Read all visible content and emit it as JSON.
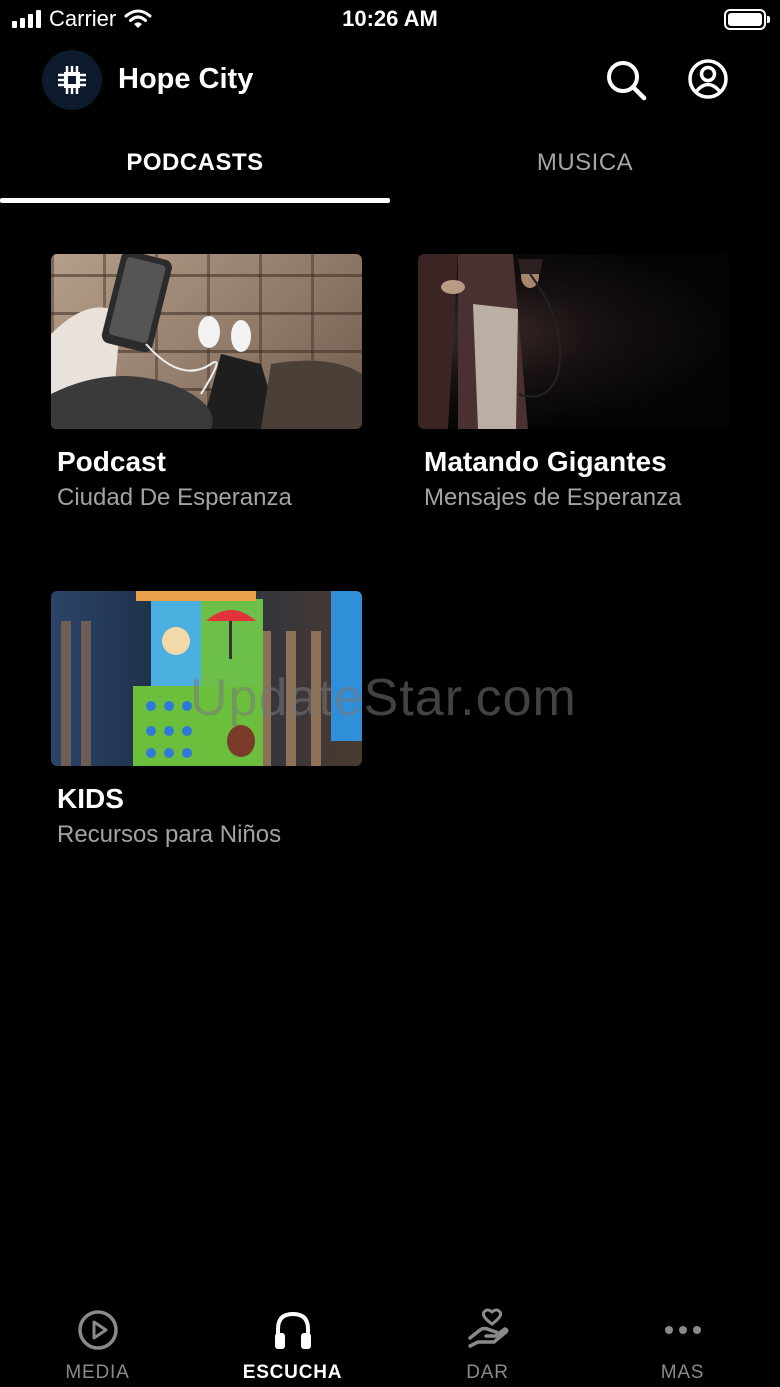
{
  "status_bar": {
    "carrier": "Carrier",
    "time": "10:26 AM"
  },
  "header": {
    "title": "Hope City",
    "logo_icon": "hope-city-logo",
    "search_icon": "search-icon",
    "account_icon": "account-icon"
  },
  "tabs": [
    {
      "label": "PODCASTS",
      "selected": true
    },
    {
      "label": "MUSICA",
      "selected": false
    }
  ],
  "cards": [
    {
      "title": "Podcast",
      "subtitle": "Ciudad De Esperanza"
    },
    {
      "title": "Matando Gigantes",
      "subtitle": "Mensajes de Esperanza"
    },
    {
      "title": "KIDS",
      "subtitle": "Recursos para Niños"
    }
  ],
  "watermark": "UpdateStar.com",
  "bottom_nav": [
    {
      "label": "MEDIA",
      "icon": "play-circle-icon",
      "active": false
    },
    {
      "label": "ESCUCHA",
      "icon": "headphones-icon",
      "active": true
    },
    {
      "label": "DAR",
      "icon": "give-heart-hand-icon",
      "active": false
    },
    {
      "label": "MAS",
      "icon": "more-dots-icon",
      "active": false
    }
  ],
  "colors": {
    "background": "#000000",
    "inactive": "#8a8a8a",
    "subtitle": "#a3a3a3"
  }
}
